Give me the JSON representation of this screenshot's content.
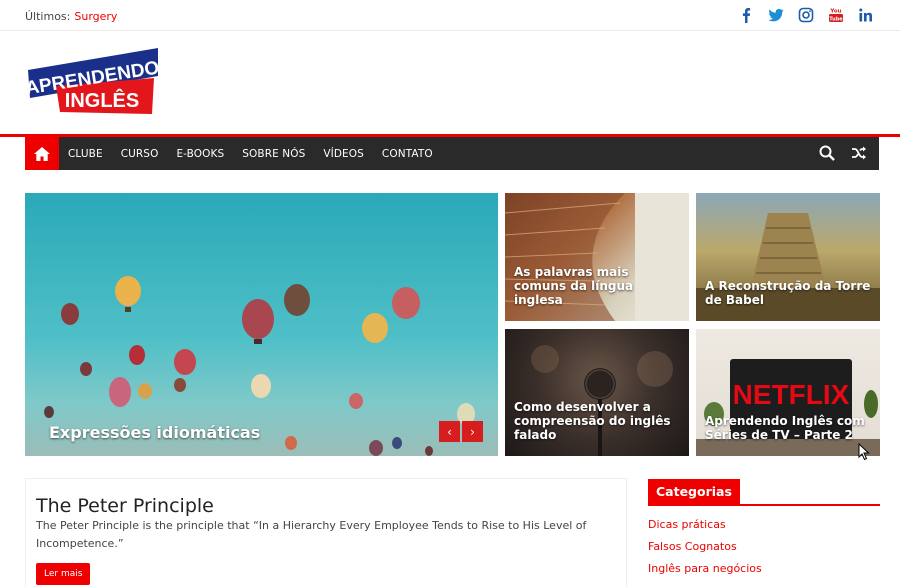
{
  "topbar": {
    "latest_label": "Últimos:",
    "latest_value": "Surgery",
    "social_icons": [
      "facebook-icon",
      "twitter-icon",
      "instagram-icon",
      "youtube-icon",
      "linkedin-icon"
    ],
    "social_color": "#1e5ba8"
  },
  "logo": {
    "line1": "APRENDENDO",
    "line2": "INGLÊS"
  },
  "nav": {
    "items": [
      "CLUBE",
      "CURSO",
      "E-BOOKS",
      "SOBRE NÓS",
      "VÍDEOS",
      "CONTATO"
    ],
    "bar_color": "#2a2a2a",
    "accent_color": "#ee0000"
  },
  "featured": {
    "main": "Expressões idiomáticas",
    "tiles": [
      "As palavras mais comuns da língua inglesa",
      "A Reconstrução da Torre de Babel",
      "Como desenvolver a compreensão do inglês falado",
      "Aprendendo Inglês com Séries de TV – Parte 2"
    ],
    "tile3_sign": "NETFLIX"
  },
  "article": {
    "title": "The Peter Principle",
    "excerpt": "The Peter Principle is the principle that “In a Hierarchy Every Employee Tends to Rise to His Level of Incompetence.”",
    "button": "Ler mais"
  },
  "sidebar": {
    "title": "Categorias",
    "items": [
      "Dicas práticas",
      "Falsos Cognatos",
      "Inglês para negócios"
    ]
  }
}
